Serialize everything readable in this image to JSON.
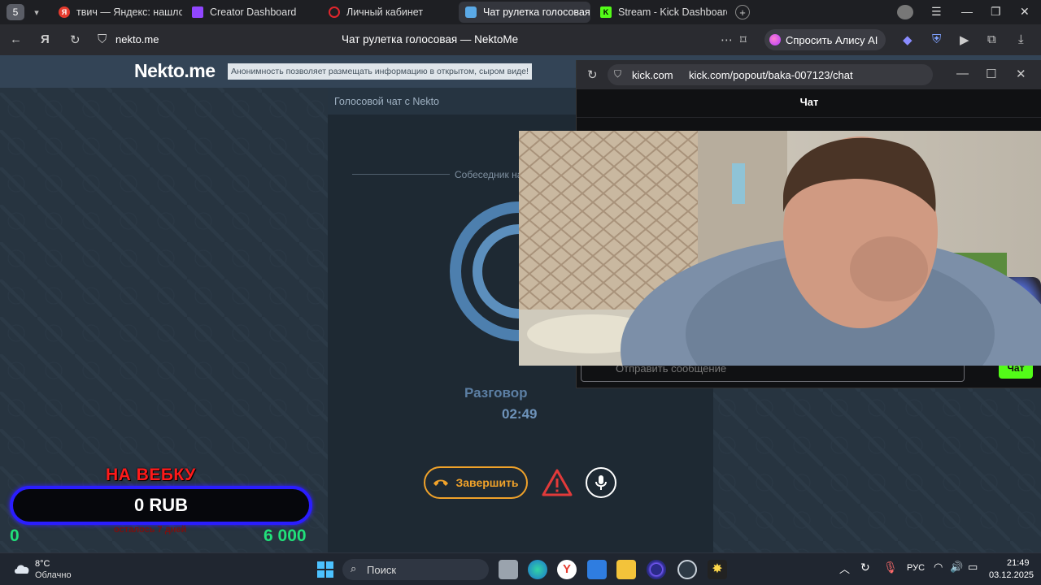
{
  "browser": {
    "tab_count": "5",
    "tabs": [
      {
        "label": "твич — Яндекс: нашлось",
        "favicon": "yandex-icon",
        "color": "#e63b2e"
      },
      {
        "label": "Creator Dashboard",
        "favicon": "twitch-icon",
        "color": "#9146ff"
      },
      {
        "label": "Личный кабинет",
        "favicon": "opera-icon",
        "color": "#e0262c"
      },
      {
        "label": "Чат рулетка голосовая",
        "favicon": "nekto-icon",
        "color": "#5aa9e6"
      },
      {
        "label": "Stream - Kick Dashboard",
        "favicon": "kick-icon",
        "color": "#53fc18"
      }
    ],
    "address_domain": "nekto.me",
    "page_title": "Чат рулетка голосовая — NektoMe",
    "alice_button": "Спросить Алису AI"
  },
  "nekto": {
    "logo": "Nekto.me",
    "notice": "Анонимность позволяет размещать информацию в открытом, сыром виде!",
    "panel_title": "Голосовой чат с Nekto",
    "found_text": "Собеседник най",
    "talk_label": "Разговор",
    "talk_time": "02:49",
    "end_button": "Завершить"
  },
  "goal_widget": {
    "title": "НА ВЕБКУ",
    "amount": "0 RUB",
    "subtitle": "осталось 7 дней",
    "min": "0",
    "max": "6 000"
  },
  "kick_popup": {
    "domain": "kick.com",
    "path": "kick.com/popout/baka-007123/chat",
    "title": "Чат",
    "input_placeholder": "Отправить сообщение",
    "send_button": "Чат"
  },
  "taskbar": {
    "temperature": "8°C",
    "weather": "Облачно",
    "search_placeholder": "Поиск",
    "language": "РУС",
    "time": "21:49",
    "date": "03.12.2025"
  }
}
